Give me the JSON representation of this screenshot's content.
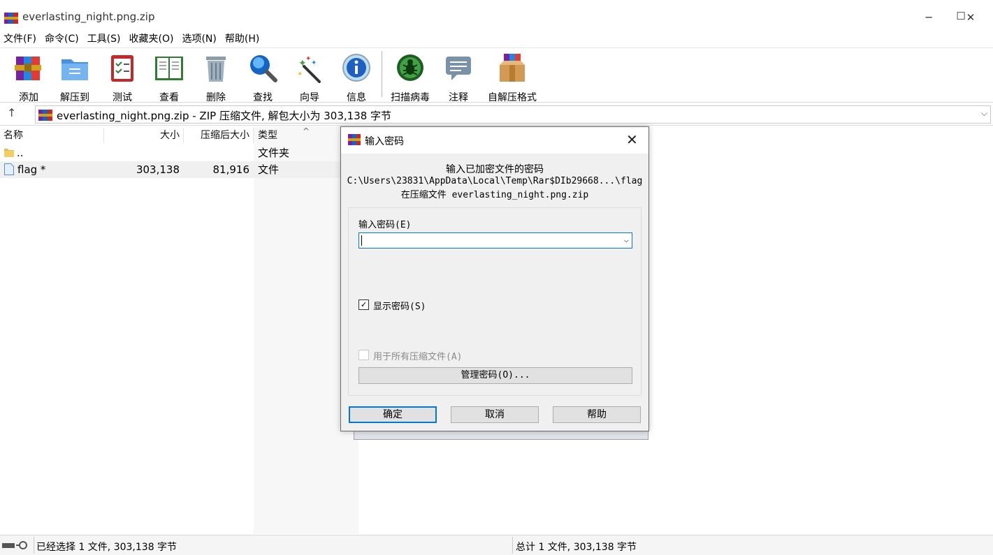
{
  "window": {
    "title": "everlasting_night.png.zip",
    "minimize_glyph": "─",
    "maximize_glyph": "☐",
    "close_glyph": "✕"
  },
  "menu": [
    "文件(F)",
    "命令(C)",
    "工具(S)",
    "收藏夹(O)",
    "选项(N)",
    "帮助(H)"
  ],
  "toolbar": [
    {
      "label": "添加",
      "icon": "add-archive-icon"
    },
    {
      "label": "解压到",
      "icon": "extract-folder-icon"
    },
    {
      "label": "测试",
      "icon": "test-clipboard-icon"
    },
    {
      "label": "查看",
      "icon": "view-book-icon"
    },
    {
      "label": "删除",
      "icon": "trash-icon"
    },
    {
      "label": "查找",
      "icon": "magnifier-icon"
    },
    {
      "label": "向导",
      "icon": "wizard-wand-icon"
    },
    {
      "label": "信息",
      "icon": "info-icon"
    },
    {
      "label": "扫描病毒",
      "icon": "virus-scan-icon"
    },
    {
      "label": "注释",
      "icon": "comment-icon"
    },
    {
      "label": "自解压格式",
      "icon": "sfx-box-icon"
    }
  ],
  "address": {
    "up_glyph": "↑",
    "text": "everlasting_night.png.zip - ZIP 压缩文件, 解包大小为 303,138 字节",
    "dropdown_glyph": "⌵"
  },
  "columns": {
    "name": "名称",
    "size": "大小",
    "packed": "压缩后大小",
    "type": "类型",
    "sort_glyph": "^"
  },
  "files": [
    {
      "name": "..",
      "size": "",
      "packed": "",
      "type": "文件夹",
      "icon": "folder-icon"
    },
    {
      "name": "flag *",
      "size": "303,138",
      "packed": "81,916",
      "type": "文件",
      "icon": "file-icon"
    }
  ],
  "status": {
    "left": "已经选择 1 文件, 303,138 字节",
    "right": "总计 1 文件, 303,138 字节"
  },
  "dialog": {
    "title": "输入密码",
    "close_glyph": "✕",
    "prompt": "输入已加密文件的密码",
    "path": "C:\\Users\\23831\\AppData\\Local\\Temp\\Rar$DIb29668...\\flag",
    "archive_line": "在压缩文件 everlasting_night.png.zip",
    "password_label": "输入密码(E)",
    "password_value": "",
    "dropdown_glyph": "⌵",
    "show_password_label": "显示密码(S)",
    "show_password_checked": true,
    "check_glyph": "✓",
    "use_all_label": "用于所有压缩文件(A)",
    "use_all_checked": false,
    "manage_label": "管理密码(O)...",
    "ok_label": "确定",
    "cancel_label": "取消",
    "help_label": "帮助"
  },
  "colors": {
    "accent": "#0078d7",
    "selected_row": "#f0f0f0",
    "dialog_bg": "#f0f0f0"
  }
}
